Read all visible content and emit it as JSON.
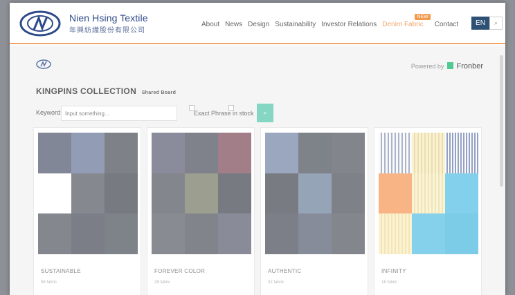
{
  "header": {
    "brand_en": "Nien Hsing Textile",
    "brand_zh": "年興紡織股份有限公司",
    "nav": [
      "About",
      "News",
      "Design",
      "Sustainability",
      "Investor Relations",
      "Denim Fabric",
      "Contact"
    ],
    "new_badge": "NEW",
    "lang": "EN",
    "accent_color": "#f2a56c"
  },
  "powered": {
    "prefix": "Powered by",
    "brand": "Fronber"
  },
  "collection": {
    "title": "KINGPINS COLLECTION",
    "subtitle": "Shared Board"
  },
  "search": {
    "label": "Keyword:",
    "placeholder": "Input something...",
    "exact_phrase": "Exact Phrase",
    "in_stock": "in stock",
    "button_icon": "search-icon"
  },
  "cards": [
    {
      "title": "SUSTAINABLE",
      "count": "58 fabric"
    },
    {
      "title": "FOREVER COLOR",
      "count": "28 fabric"
    },
    {
      "title": "AUTHENTIC",
      "count": "32 fabric"
    },
    {
      "title": "INFINITY",
      "count": "16 fabric"
    }
  ]
}
